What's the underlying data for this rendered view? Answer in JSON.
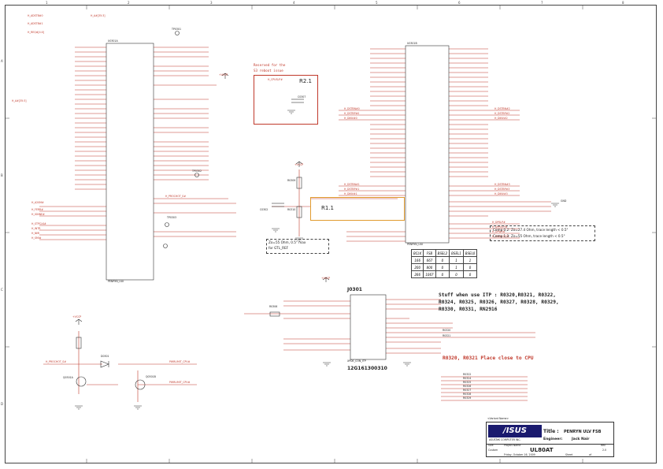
{
  "title_block": {
    "vendor_label": "<Variant Name>",
    "logo_text": "/ISUS",
    "company": "ASUSTeK COMPUTER INC.",
    "title_label": "Title :",
    "title": "PENRYN ULV FSB",
    "engineer_label": "Engineer:",
    "engineer": "Jack Nair",
    "size_label": "Size",
    "project_label": "Project Name",
    "rev_label": "Rev",
    "custom_label": "Custom",
    "project": "UL80AT",
    "rev": "2.0",
    "date": "Friday, October 16, 2009",
    "sheet_label": "Sheet",
    "of_label": "of"
  },
  "notes": {
    "reserved_line1": "Reserved for the",
    "reserved_line2": "S3 reboot issue",
    "r21": "R2.1",
    "r11": "R1.1",
    "zo_line1": "Zo=55 Ohm, 0.5\" max",
    "zo_line2": "for GTL_REF",
    "comp_line1": "Comp 0,2: Zo=27.4 Ohm, trace length < 0.5\"",
    "comp_line2": "Comp 1,3: Zo=55 Ohm, trace length < 0.5\"",
    "itp_stuff_line1": "Stuff when use ITP : R0320,R0321, R0322,",
    "itp_stuff_line2": "R0324, R0325, R0326, R0327, R0328, R0329,",
    "itp_stuff_line3": "R0330, R0331, RN2916",
    "place_close": "R0320, R0321 Place close to CPU"
  },
  "connector": {
    "ref": "J0301",
    "name": "XPDE_CON_ITP",
    "part": "12G161300310"
  },
  "cpu_ref": "U0301A",
  "cpu_ref_b": "U0301B",
  "cpu_part": "PENRYN_ULV",
  "bsel_table": {
    "header": [
      "BCLK",
      "FSB",
      "BSEL2",
      "BSEL1",
      "BSEL0"
    ],
    "rows": [
      [
        "166",
        "667",
        "0",
        "1",
        "1"
      ],
      [
        "200",
        "800",
        "0",
        "1",
        "0"
      ],
      [
        "266",
        "1067",
        "0",
        "0",
        "0"
      ]
    ]
  },
  "labels_left": {
    "h_a20m": "H_A20M#",
    "h_ferr": "H_FERR#",
    "h_ignne": "H_IGNNE#",
    "h_stpclk": "H_STPCLK#",
    "h_intr": "H_INTR",
    "h_nmi": "H_NMI",
    "h_smi": "H_SMI#",
    "h_addstb0": "H_ADSTB#0",
    "h_addstb1": "H_ADSTB#1",
    "h_req": "H_REQ#[4:0]",
    "h_a": "H_A#[35:3]",
    "h_prochot": "H_PROCHOT_S#",
    "prochot_cpu": "PWRLIMIT_CPU#",
    "pwrlimit_cpu": "PWRLIMIT_CPU#"
  },
  "labels_right": {
    "vccp": "+VCCP",
    "h_dstbn0": "H_DSTBN#0",
    "h_dstbp0": "H_DSTBP#0",
    "h_dinv0": "H_DINV#0",
    "h_dstbn1": "H_DSTBN#1",
    "h_dstbp1": "H_DSTBP#1",
    "h_dinv1": "H_DINV#1",
    "h_dstbn2": "H_DSTBN#2",
    "h_dstbp2": "H_DSTBP#2",
    "h_dinv2": "H_DINV#2",
    "h_dstbn3": "H_DSTBN#3",
    "h_dstbp3": "H_DSTBP#3",
    "h_dinv3": "H_DINV#3",
    "h_dpslp": "H_DPSLP#",
    "h_dprstp": "H_DPRSTP#",
    "h_dpwr": "H_DPWR#",
    "h_pwrgd": "H_PWRGOOD",
    "h_cpuslp": "H_CPUSLP#",
    "h_psi": "H_PSI#",
    "gnd": "GND"
  },
  "components": {
    "tp0301": "TP0301",
    "tp0302": "TP0302",
    "tp0303": "TP0303",
    "rn0301": "RN0301",
    "r0309": "R0309",
    "r0310": "R0310",
    "r0311": "R0311",
    "c0307": "C0307",
    "c0302": "C0302",
    "q0301a": "Q0301A",
    "q0301b": "Q0301B",
    "r0306": "R0306",
    "d0301": "D0301",
    "r0320": "R0320",
    "r0321": "R0321",
    "r0322": "R0322",
    "r0324": "R0324",
    "r0325": "R0325",
    "r0326": "R0326",
    "r0327": "R0327",
    "r0328": "R0328",
    "r0329": "R0329",
    "r0330": "R0330",
    "r0331": "R0331"
  },
  "zones": {
    "top": [
      "1",
      "2",
      "3",
      "4",
      "5",
      "6",
      "7",
      "8"
    ],
    "side": [
      "A",
      "B",
      "C",
      "D"
    ]
  }
}
